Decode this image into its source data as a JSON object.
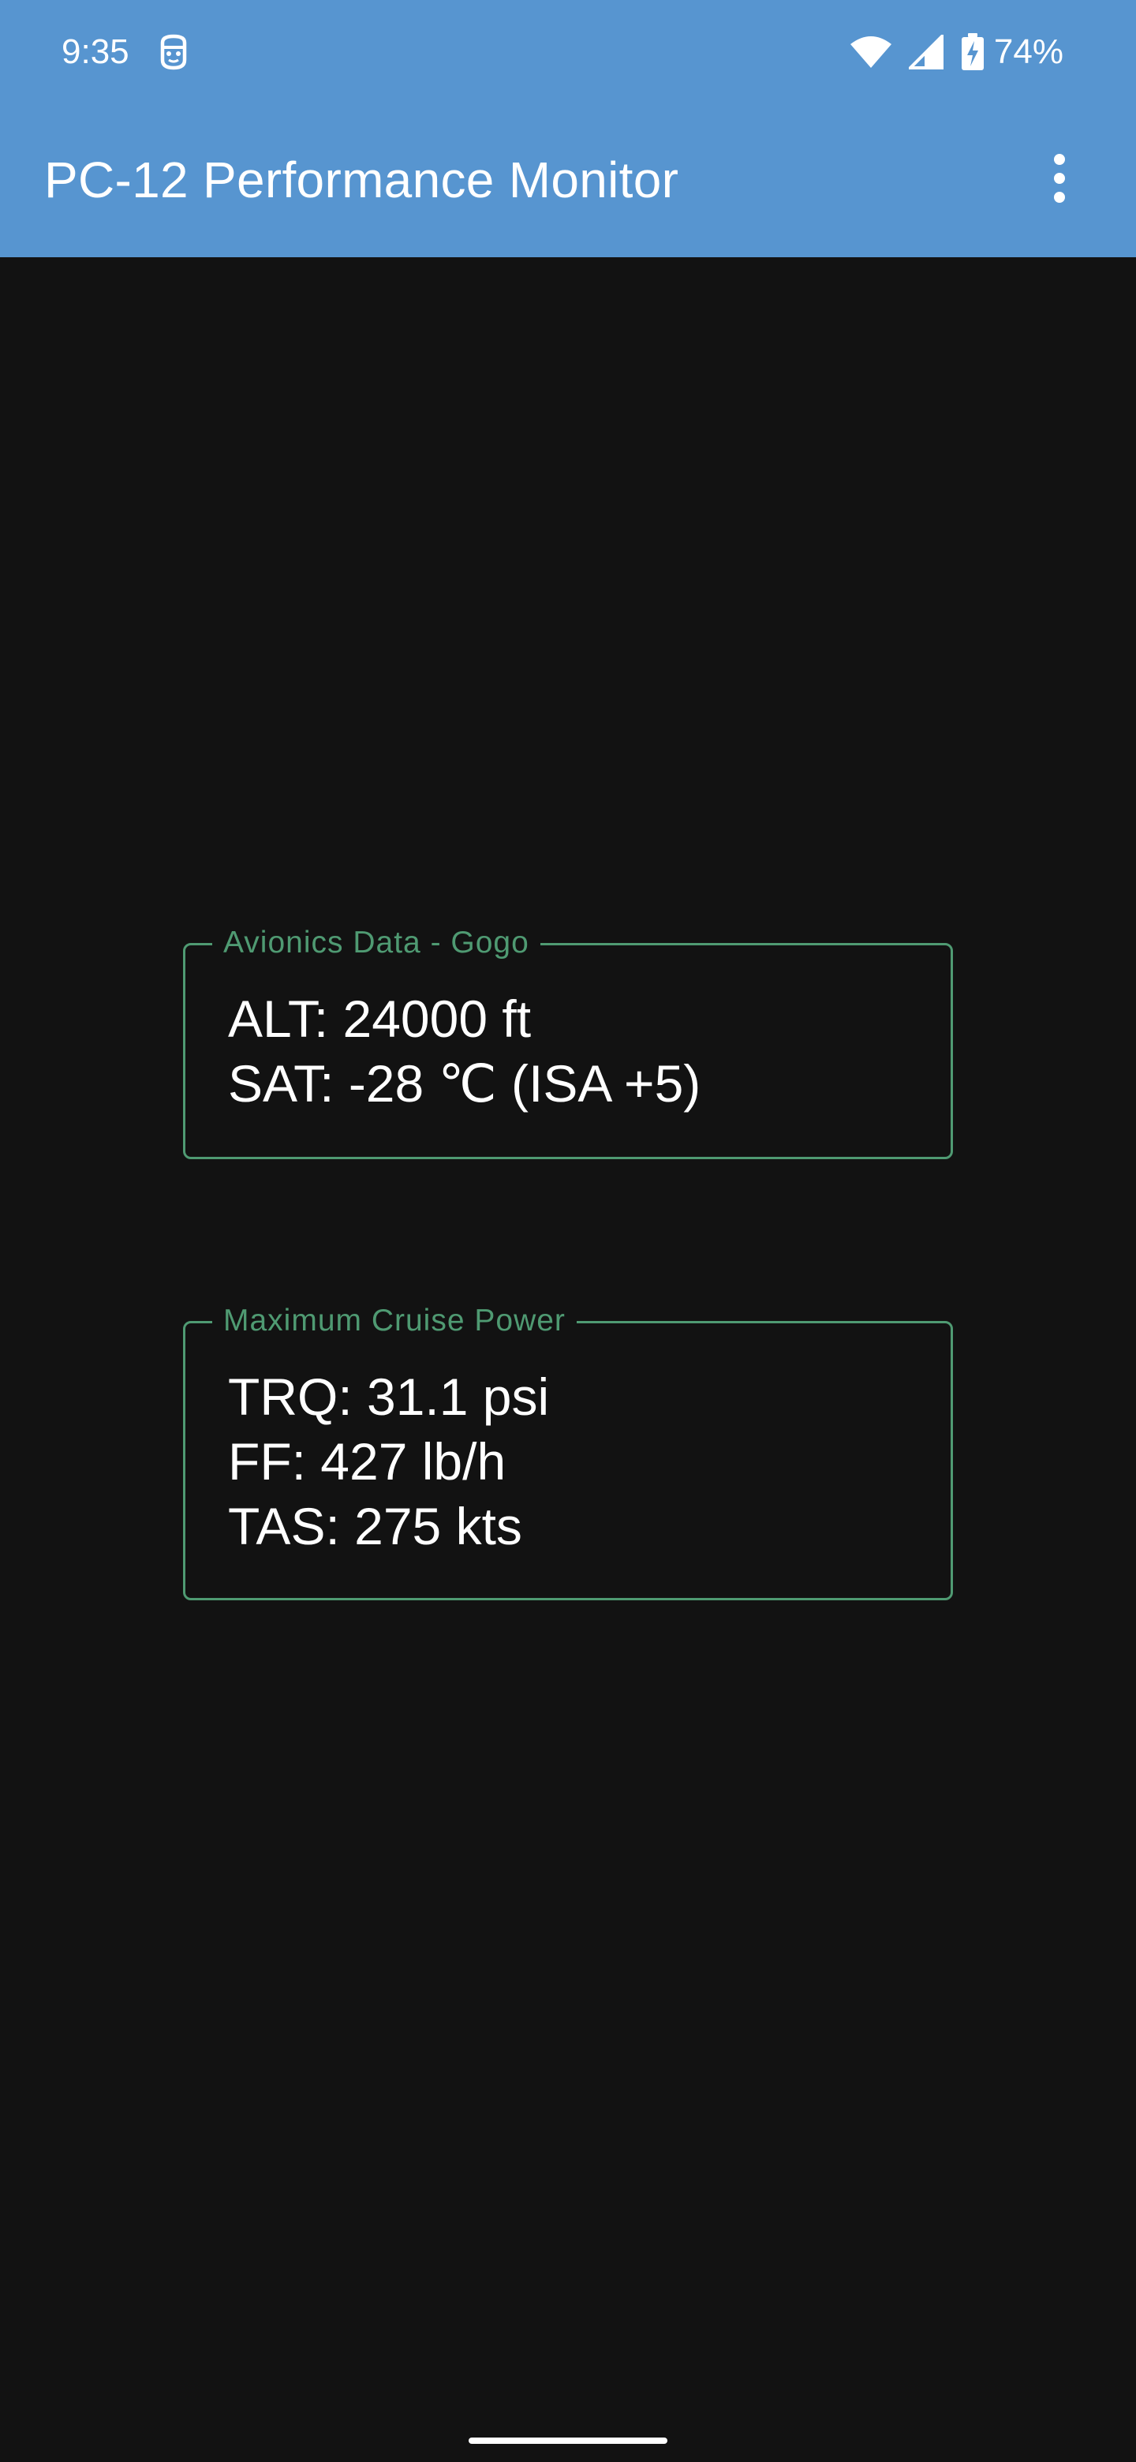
{
  "status_bar": {
    "time": "9:35",
    "notification_icon": "face-icon",
    "wifi_icon": "wifi-icon",
    "signal_icon": "signal-icon",
    "battery_icon": "battery-charging-icon",
    "battery_percent": "74%"
  },
  "app_bar": {
    "title": "PC-12 Performance Monitor",
    "menu_icon": "more-vert-icon",
    "background_color": "#5795d0"
  },
  "panels": [
    {
      "title": "Avionics Data - Gogo",
      "lines": [
        "ALT: 24000 ft",
        "SAT: -28 ℃ (ISA +5)"
      ]
    },
    {
      "title": "Maximum Cruise Power",
      "lines": [
        "TRQ: 31.1 psi",
        "FF: 427 lb/h",
        "TAS: 275 kts"
      ]
    }
  ],
  "colors": {
    "background": "#121212",
    "panel_border": "#4f9a72",
    "text": "#ffffff"
  }
}
